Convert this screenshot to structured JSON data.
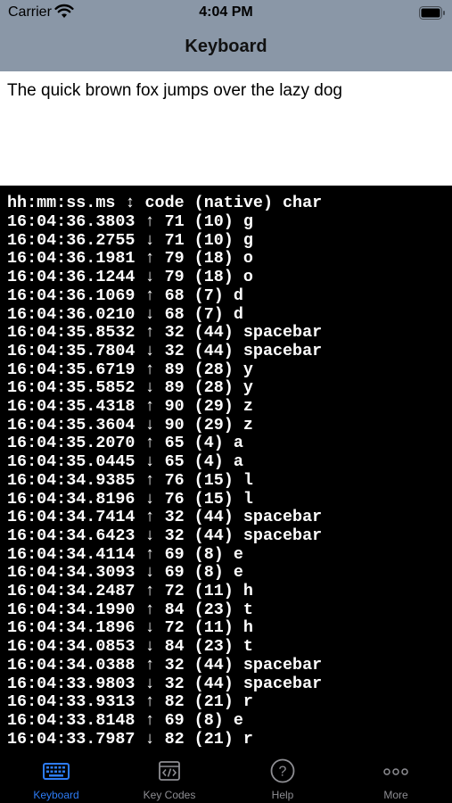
{
  "status_bar": {
    "carrier": "Carrier",
    "time": "4:04 PM"
  },
  "nav": {
    "title": "Keyboard"
  },
  "text_area": {
    "content": "The quick brown fox jumps over the lazy dog"
  },
  "log": {
    "header": "hh:mm:ss.ms ↕ code (native) char",
    "lines": [
      "16:04:36.3803 ↑ 71 (10) g",
      "16:04:36.2755 ↓ 71 (10) g",
      "16:04:36.1981 ↑ 79 (18) o",
      "16:04:36.1244 ↓ 79 (18) o",
      "16:04:36.1069 ↑ 68 (7) d",
      "16:04:36.0210 ↓ 68 (7) d",
      "16:04:35.8532 ↑ 32 (44) spacebar",
      "16:04:35.7804 ↓ 32 (44) spacebar",
      "16:04:35.6719 ↑ 89 (28) y",
      "16:04:35.5852 ↓ 89 (28) y",
      "16:04:35.4318 ↑ 90 (29) z",
      "16:04:35.3604 ↓ 90 (29) z",
      "16:04:35.2070 ↑ 65 (4) a",
      "16:04:35.0445 ↓ 65 (4) a",
      "16:04:34.9385 ↑ 76 (15) l",
      "16:04:34.8196 ↓ 76 (15) l",
      "16:04:34.7414 ↑ 32 (44) spacebar",
      "16:04:34.6423 ↓ 32 (44) spacebar",
      "16:04:34.4114 ↑ 69 (8) e",
      "16:04:34.3093 ↓ 69 (8) e",
      "16:04:34.2487 ↑ 72 (11) h",
      "16:04:34.1990 ↑ 84 (23) t",
      "16:04:34.1896 ↓ 72 (11) h",
      "16:04:34.0853 ↓ 84 (23) t",
      "16:04:34.0388 ↑ 32 (44) spacebar",
      "16:04:33.9803 ↓ 32 (44) spacebar",
      "16:04:33.9313 ↑ 82 (21) r",
      "16:04:33.8148 ↑ 69 (8) e",
      "16:04:33.7987 ↓ 82 (21) r"
    ]
  },
  "tabs": [
    {
      "label": "Keyboard",
      "icon": "keyboard-icon",
      "active": true
    },
    {
      "label": "Key Codes",
      "icon": "code-icon",
      "active": false
    },
    {
      "label": "Help",
      "icon": "help-icon",
      "active": false
    },
    {
      "label": "More",
      "icon": "more-icon",
      "active": false
    }
  ],
  "colors": {
    "bar": "#8a97a7",
    "accent": "#2d7cf6",
    "inactive": "#8e8e93"
  }
}
